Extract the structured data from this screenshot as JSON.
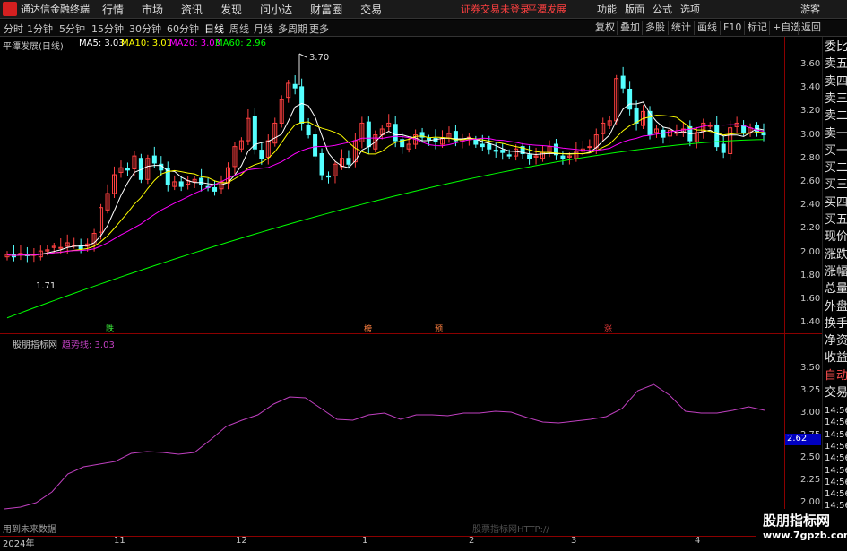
{
  "menubar": {
    "app_title": "通达信金融终端",
    "items": [
      "行情",
      "市场",
      "资讯",
      "发现",
      "问小达",
      "财富圈",
      "交易"
    ],
    "warning": "证券交易未登录",
    "stock_name": "平潭发展",
    "right_items": [
      "功能",
      "版面",
      "公式",
      "选项"
    ],
    "user": "游客"
  },
  "toolbar": {
    "periods": [
      "分时",
      "1分钟",
      "5分钟",
      "15分钟",
      "30分钟",
      "60分钟",
      "日线",
      "周线",
      "月线",
      "多周期",
      "更多"
    ],
    "active_period": "日线",
    "right_buttons": [
      "复权",
      "叠加",
      "多股",
      "统计",
      "画线",
      "F10",
      "标记",
      "+自选",
      "返回"
    ]
  },
  "main_chart": {
    "title": "平潭发展(日线)",
    "ma_labels": [
      {
        "text": "MA5: 3.03",
        "color": "#ffffff"
      },
      {
        "text": "MA10: 3.01",
        "color": "#ffff00"
      },
      {
        "text": "MA20: 3.03",
        "color": "#ff00ff"
      },
      {
        "text": "MA60: 2.96",
        "color": "#00ff00"
      }
    ],
    "high_label": "3.70",
    "low_label": "1.71",
    "y_ticks": [
      "3.60",
      "3.40",
      "3.20",
      "3.00",
      "2.80",
      "2.60",
      "2.40",
      "2.20",
      "2.00",
      "1.80",
      "1.60",
      "1.40"
    ],
    "markers": [
      {
        "text": "跌",
        "color": "#40ff40"
      },
      {
        "text": "榜",
        "color": "#ff8040"
      },
      {
        "text": "预",
        "color": "#ff8040"
      },
      {
        "text": "涨",
        "color": "#ff4040"
      }
    ]
  },
  "sub_chart": {
    "title": "股朋指标网",
    "line_label": "趋势线: 3.03",
    "line_color": "#c040c0",
    "current_value": "2.62",
    "y_ticks": [
      "3.50",
      "3.25",
      "3.00",
      "2.75",
      "2.50",
      "2.25",
      "2.00"
    ],
    "footer_left": "用到未来数据",
    "footer_mid": "股票指标网HTTP://"
  },
  "x_axis": {
    "labels": [
      "2024年",
      "11",
      "12",
      "1",
      "2",
      "3",
      "4"
    ]
  },
  "side_panel": {
    "items": [
      "委比",
      "卖五",
      "卖四",
      "卖三",
      "卖二",
      "卖一",
      "买一",
      "买二",
      "买三",
      "买四",
      "买五",
      "现价",
      "涨跌",
      "涨幅",
      "总量",
      "外盘",
      "换手",
      "净资",
      "收益",
      "自动",
      "交易"
    ],
    "time_items": [
      "14:56",
      "14:56",
      "14:56",
      "14:56",
      "14:56",
      "14:56",
      "14:56",
      "14:56",
      "14:56",
      "14:56",
      "14:56",
      "14:56"
    ]
  },
  "watermark": {
    "line1": "股朋指标网",
    "line2": "www.7gpzb.com"
  },
  "chart_data": [
    {
      "type": "candlestick",
      "title": "平潭发展(日线)",
      "ylim": [
        1.4,
        3.7
      ],
      "close": [
        1.98,
        1.96,
        1.99,
        1.97,
        1.98,
        2.01,
        2.02,
        2.05,
        2.04,
        2.08,
        2.06,
        2.03,
        2.07,
        2.16,
        2.38,
        2.5,
        2.66,
        2.72,
        2.7,
        2.82,
        2.62,
        2.8,
        2.76,
        2.7,
        2.58,
        2.6,
        2.56,
        2.61,
        2.62,
        2.58,
        2.55,
        2.52,
        2.6,
        2.72,
        2.9,
        2.95,
        3.14,
        2.88,
        2.8,
        2.95,
        3.1,
        3.3,
        3.44,
        3.4,
        3.1,
        3.0,
        2.82,
        2.66,
        2.64,
        2.75,
        2.8,
        2.75,
        2.95,
        3.1,
        2.9,
        3.0,
        3.05,
        3.1,
        2.95,
        2.9,
        2.92,
        3.0,
        2.98,
        2.96,
        2.94,
        2.97,
        3.01,
        2.95,
        2.96,
        2.98,
        2.92,
        2.9,
        2.88,
        2.86,
        2.85,
        2.82,
        2.88,
        2.84,
        2.8,
        2.82,
        2.85,
        2.9,
        2.83,
        2.8,
        2.82,
        2.86,
        2.88,
        2.9,
        3.0,
        3.1,
        3.12,
        3.48,
        3.4,
        3.22,
        3.1,
        3.2,
        3.0,
        3.05,
        2.98,
        3.04,
        3.02,
        3.05,
        2.95,
        3.02,
        3.1,
        3.08,
        2.9,
        2.85,
        3.06,
        3.1,
        3.02,
        3.06,
        3.03,
        3.0
      ],
      "ma5_last": 3.03,
      "ma10_last": 3.01,
      "ma20_last": 3.03,
      "ma60_last": 2.96,
      "high": 3.7,
      "low": 1.71
    },
    {
      "type": "line",
      "series": [
        {
          "name": "趋势线",
          "values": [
            1.93,
            1.95,
            2.0,
            2.12,
            2.32,
            2.4,
            2.43,
            2.46,
            2.55,
            2.57,
            2.56,
            2.54,
            2.56,
            2.7,
            2.85,
            2.92,
            2.98,
            3.1,
            3.18,
            3.17,
            3.05,
            2.93,
            2.92,
            2.98,
            3.0,
            2.93,
            2.98,
            2.98,
            2.97,
            3.0,
            3.0,
            3.02,
            3.01,
            2.95,
            2.9,
            2.89,
            2.91,
            2.93,
            2.96,
            3.05,
            3.25,
            3.32,
            3.2,
            3.02,
            3.0,
            3.0,
            3.03,
            3.07,
            3.03
          ]
        }
      ],
      "ylim": [
        2.0,
        3.62
      ],
      "last_value": 3.03
    }
  ]
}
